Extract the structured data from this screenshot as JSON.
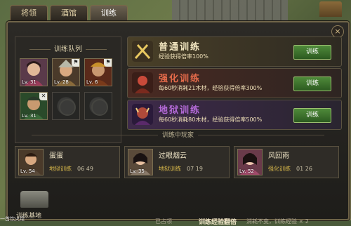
{
  "tabs": [
    {
      "label": "将领"
    },
    {
      "label": "酒馆"
    },
    {
      "label": "训练"
    }
  ],
  "close_label": "×",
  "queue": {
    "title": "训练队列",
    "slots": [
      {
        "level": "Lv. 31",
        "corner": ""
      },
      {
        "level": "Lv. 28",
        "corner": "⚑"
      },
      {
        "level": "Lv. 6",
        "corner": "⚑"
      },
      {
        "level": "Lv. 31",
        "corner": "✕"
      }
    ]
  },
  "training": [
    {
      "title": "普通训练",
      "desc": "经验获得倍率100%",
      "button": "训练",
      "color": "#f2e6c0"
    },
    {
      "title": "强化训练",
      "desc": "每60秒消耗21木材，经验获得倍率300%",
      "button": "训练",
      "color": "#e46a4a"
    },
    {
      "title": "地狱训练",
      "desc": "每60秒消耗80木材，经验获得倍率500%",
      "button": "训练",
      "color": "#b46ad8"
    }
  ],
  "section_label": "训练中玩家",
  "players": [
    {
      "name": "蛋蛋",
      "level": "Lv. 54",
      "mode": "地狱训练",
      "time": "06 49"
    },
    {
      "name": "过眼烟云",
      "level": "Lv. 35",
      "mode": "地狱训练",
      "time": "07 19"
    },
    {
      "name": "风回雨",
      "level": "Lv. 52",
      "mode": "强化训练",
      "time": "01 26"
    }
  ],
  "footer": {
    "base_label": "训练基地",
    "occupied": "已占领",
    "double": "训练经验翻倍",
    "note": "消耗不变，训练经验 × 2"
  },
  "bottom_strip": "一首饮火炬"
}
